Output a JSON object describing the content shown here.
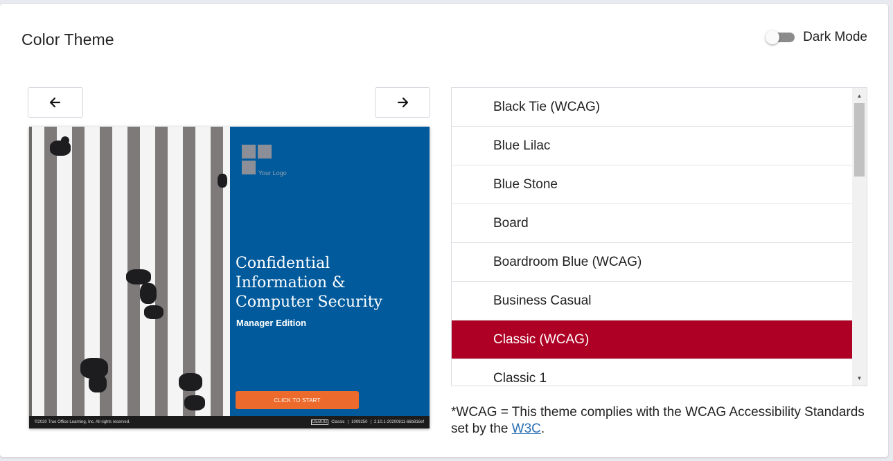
{
  "header": {
    "title": "Color Theme",
    "dark_mode_label": "Dark Mode",
    "dark_mode_on": false
  },
  "preview": {
    "prev_icon": "arrow-left-icon",
    "next_icon": "arrow-right-icon",
    "logo_text": "Your Logo",
    "course_title_lines": [
      "Confidential",
      "Information &",
      "Computer Security"
    ],
    "course_subtitle": "Manager Edition",
    "start_label": "CLICK TO START",
    "footer_copyright": "©2020 True Office Learning, Inc. All rights reserved.",
    "footer_debug": "DEBUG",
    "footer_theme": "Classic",
    "footer_sep1": "|",
    "footer_id": "1009250",
    "footer_sep2": "|",
    "footer_version": "2.10.1-20200811-66b816ef",
    "accent_blue": "#005a9c",
    "button_orange": "#ec6a2c"
  },
  "themes": {
    "items": [
      "Black Tie (WCAG)",
      "Blue Lilac",
      "Blue Stone",
      "Board",
      "Boardroom Blue (WCAG)",
      "Business Casual",
      "Classic (WCAG)",
      "Classic 1"
    ],
    "selected_index": 6,
    "selected_color": "#ae0024"
  },
  "note": {
    "text_before": "*WCAG = This theme complies with the WCAG Accessibility Standards set by the ",
    "link_text": "W3C",
    "text_after": "."
  }
}
